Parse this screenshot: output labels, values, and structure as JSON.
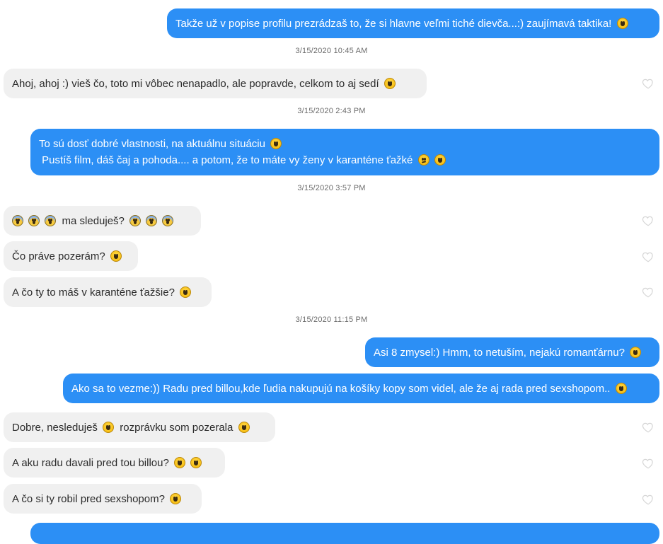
{
  "colors": {
    "outgoing": "#2c8ff5",
    "incoming": "#f0f0f0",
    "timestamp": "#6b6b6b",
    "heart": "#d6d6d6"
  },
  "messages": [
    {
      "id": "m1",
      "direction": "out",
      "lines": [
        {
          "text": "Takže už v popise profilu prezrádzaš to, že si hlavne veľmi tiché dievča...:) zaujímavá taktika!",
          "emojis": [
            "grin"
          ]
        }
      ]
    },
    {
      "id": "ts1",
      "timestamp": "3/15/2020 10:45 AM"
    },
    {
      "id": "m2",
      "direction": "in",
      "lines": [
        {
          "text": "Ahoj, ahoj :) vieš čo, toto mi vôbec nenapadlo, ale popravde, celkom to aj sedí",
          "emojis": [
            "happy"
          ]
        }
      ]
    },
    {
      "id": "ts2",
      "timestamp": "3/15/2020 2:43 PM"
    },
    {
      "id": "m3",
      "direction": "out",
      "lines": [
        {
          "text": "To sú dosť dobré vlastnosti, na aktuálnu situáciu",
          "emojis": [
            "grin"
          ]
        },
        {
          "text": " Pustíš film, dáš čaj a pohoda.... a potom, že to máte vy ženy v karanténe ťažké",
          "emojis": [
            "confused",
            "grin"
          ]
        }
      ]
    },
    {
      "id": "ts3",
      "timestamp": "3/15/2020 3:57 PM"
    },
    {
      "id": "m4",
      "direction": "in",
      "lines": [
        {
          "pre_emojis": [
            "scream",
            "scream",
            "scream"
          ],
          "text": "ma sleduješ?",
          "emojis": [
            "scream",
            "scream",
            "scream"
          ]
        }
      ]
    },
    {
      "id": "m5",
      "direction": "in",
      "lines": [
        {
          "text": "Čo práve pozerám?",
          "emojis": [
            "happy"
          ]
        }
      ]
    },
    {
      "id": "m6",
      "direction": "in",
      "lines": [
        {
          "text": "A čo ty to máš v karanténe ťažšie?",
          "emojis": [
            "happy"
          ]
        }
      ]
    },
    {
      "id": "ts4",
      "timestamp": "3/15/2020 11:15 PM"
    },
    {
      "id": "m7",
      "direction": "out",
      "lines": [
        {
          "text": "Asi 8 zmysel:) Hmm, to netuším, nejakú romanťárnu?",
          "emojis": [
            "smirk"
          ]
        }
      ]
    },
    {
      "id": "m8",
      "direction": "out",
      "lines": [
        {
          "text": "Ako sa to vezme:)) Radu pred billou,kde ľudia nakupujú na košíky kopy som videl, ale že aj rada pred sexshopom..",
          "emojis": [
            "happy"
          ]
        }
      ]
    },
    {
      "id": "m9",
      "direction": "in",
      "lines": [
        {
          "text": "Dobre, nesleduješ",
          "mid_emoji": "happy",
          "text2": "rozprávku som pozerala",
          "emojis": [
            "happy"
          ]
        }
      ]
    },
    {
      "id": "m10",
      "direction": "in",
      "lines": [
        {
          "text": "A aku radu davali pred tou billou?",
          "emojis": [
            "happy",
            "happy"
          ]
        }
      ]
    },
    {
      "id": "m11",
      "direction": "in",
      "lines": [
        {
          "text": "A čo si ty robil pred sexshopom?",
          "emojis": [
            "happy"
          ]
        }
      ]
    }
  ]
}
